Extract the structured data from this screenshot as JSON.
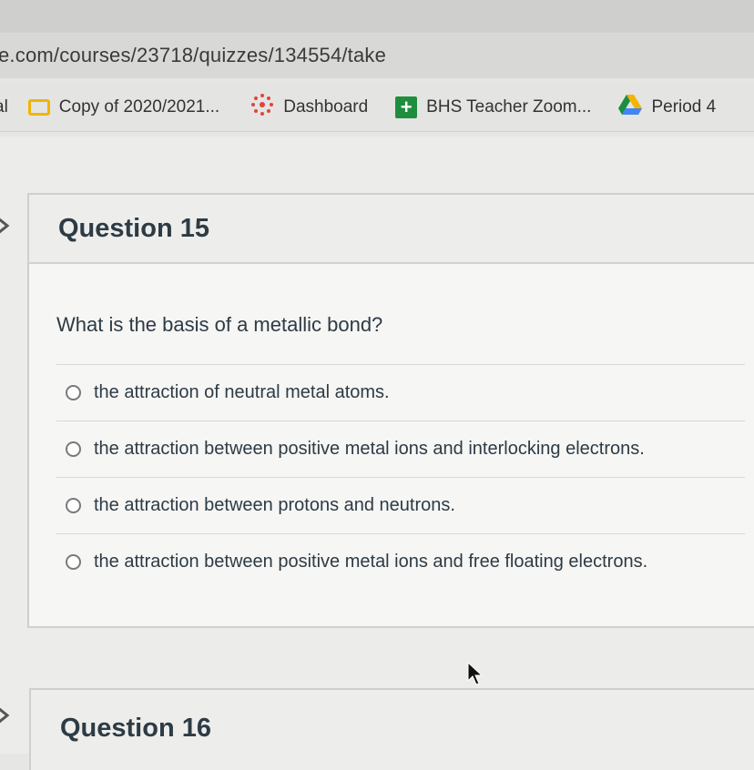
{
  "browser": {
    "url": "e.com/courses/23718/quizzes/134554/take",
    "bookmarks": [
      {
        "label": "al",
        "icon": "truncated-bookmark"
      },
      {
        "label": "Copy of 2020/2021...",
        "icon": "folder-icon"
      },
      {
        "label": "Dashboard",
        "icon": "canvas-logo-icon"
      },
      {
        "label": "BHS Teacher Zoom...",
        "icon": "plus-icon"
      },
      {
        "label": "Period 4",
        "icon": "google-drive-icon"
      }
    ]
  },
  "quiz": {
    "question15": {
      "title": "Question 15",
      "text": "What is the basis of a metallic bond?",
      "answers": [
        "the attraction of neutral metal atoms.",
        "the attraction between positive metal ions and interlocking electrons.",
        "the attraction between protons and neutrons.",
        "the attraction between positive metal ions and free floating electrons."
      ]
    },
    "question16": {
      "title": "Question 16"
    }
  },
  "colors": {
    "text": "#2d3b45",
    "folder": "#f2b400",
    "plus": "#1e8e3e",
    "canvas": "#e0443d"
  }
}
